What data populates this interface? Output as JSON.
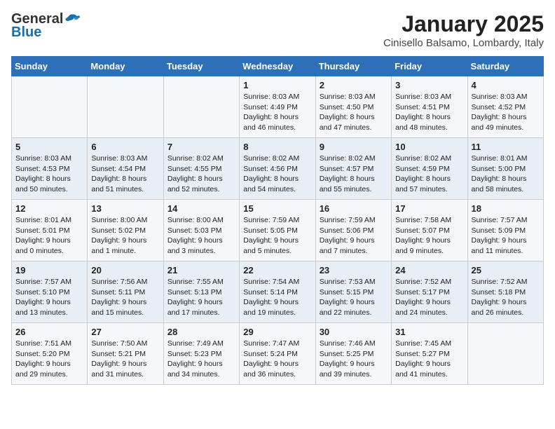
{
  "logo": {
    "general": "General",
    "blue": "Blue"
  },
  "header": {
    "month": "January 2025",
    "location": "Cinisello Balsamo, Lombardy, Italy"
  },
  "weekdays": [
    "Sunday",
    "Monday",
    "Tuesday",
    "Wednesday",
    "Thursday",
    "Friday",
    "Saturday"
  ],
  "weeks": [
    [
      {
        "day": "",
        "info": ""
      },
      {
        "day": "",
        "info": ""
      },
      {
        "day": "",
        "info": ""
      },
      {
        "day": "1",
        "info": "Sunrise: 8:03 AM\nSunset: 4:49 PM\nDaylight: 8 hours and 46 minutes."
      },
      {
        "day": "2",
        "info": "Sunrise: 8:03 AM\nSunset: 4:50 PM\nDaylight: 8 hours and 47 minutes."
      },
      {
        "day": "3",
        "info": "Sunrise: 8:03 AM\nSunset: 4:51 PM\nDaylight: 8 hours and 48 minutes."
      },
      {
        "day": "4",
        "info": "Sunrise: 8:03 AM\nSunset: 4:52 PM\nDaylight: 8 hours and 49 minutes."
      }
    ],
    [
      {
        "day": "5",
        "info": "Sunrise: 8:03 AM\nSunset: 4:53 PM\nDaylight: 8 hours and 50 minutes."
      },
      {
        "day": "6",
        "info": "Sunrise: 8:03 AM\nSunset: 4:54 PM\nDaylight: 8 hours and 51 minutes."
      },
      {
        "day": "7",
        "info": "Sunrise: 8:02 AM\nSunset: 4:55 PM\nDaylight: 8 hours and 52 minutes."
      },
      {
        "day": "8",
        "info": "Sunrise: 8:02 AM\nSunset: 4:56 PM\nDaylight: 8 hours and 54 minutes."
      },
      {
        "day": "9",
        "info": "Sunrise: 8:02 AM\nSunset: 4:57 PM\nDaylight: 8 hours and 55 minutes."
      },
      {
        "day": "10",
        "info": "Sunrise: 8:02 AM\nSunset: 4:59 PM\nDaylight: 8 hours and 57 minutes."
      },
      {
        "day": "11",
        "info": "Sunrise: 8:01 AM\nSunset: 5:00 PM\nDaylight: 8 hours and 58 minutes."
      }
    ],
    [
      {
        "day": "12",
        "info": "Sunrise: 8:01 AM\nSunset: 5:01 PM\nDaylight: 9 hours and 0 minutes."
      },
      {
        "day": "13",
        "info": "Sunrise: 8:00 AM\nSunset: 5:02 PM\nDaylight: 9 hours and 1 minute."
      },
      {
        "day": "14",
        "info": "Sunrise: 8:00 AM\nSunset: 5:03 PM\nDaylight: 9 hours and 3 minutes."
      },
      {
        "day": "15",
        "info": "Sunrise: 7:59 AM\nSunset: 5:05 PM\nDaylight: 9 hours and 5 minutes."
      },
      {
        "day": "16",
        "info": "Sunrise: 7:59 AM\nSunset: 5:06 PM\nDaylight: 9 hours and 7 minutes."
      },
      {
        "day": "17",
        "info": "Sunrise: 7:58 AM\nSunset: 5:07 PM\nDaylight: 9 hours and 9 minutes."
      },
      {
        "day": "18",
        "info": "Sunrise: 7:57 AM\nSunset: 5:09 PM\nDaylight: 9 hours and 11 minutes."
      }
    ],
    [
      {
        "day": "19",
        "info": "Sunrise: 7:57 AM\nSunset: 5:10 PM\nDaylight: 9 hours and 13 minutes."
      },
      {
        "day": "20",
        "info": "Sunrise: 7:56 AM\nSunset: 5:11 PM\nDaylight: 9 hours and 15 minutes."
      },
      {
        "day": "21",
        "info": "Sunrise: 7:55 AM\nSunset: 5:13 PM\nDaylight: 9 hours and 17 minutes."
      },
      {
        "day": "22",
        "info": "Sunrise: 7:54 AM\nSunset: 5:14 PM\nDaylight: 9 hours and 19 minutes."
      },
      {
        "day": "23",
        "info": "Sunrise: 7:53 AM\nSunset: 5:15 PM\nDaylight: 9 hours and 22 minutes."
      },
      {
        "day": "24",
        "info": "Sunrise: 7:52 AM\nSunset: 5:17 PM\nDaylight: 9 hours and 24 minutes."
      },
      {
        "day": "25",
        "info": "Sunrise: 7:52 AM\nSunset: 5:18 PM\nDaylight: 9 hours and 26 minutes."
      }
    ],
    [
      {
        "day": "26",
        "info": "Sunrise: 7:51 AM\nSunset: 5:20 PM\nDaylight: 9 hours and 29 minutes."
      },
      {
        "day": "27",
        "info": "Sunrise: 7:50 AM\nSunset: 5:21 PM\nDaylight: 9 hours and 31 minutes."
      },
      {
        "day": "28",
        "info": "Sunrise: 7:49 AM\nSunset: 5:23 PM\nDaylight: 9 hours and 34 minutes."
      },
      {
        "day": "29",
        "info": "Sunrise: 7:47 AM\nSunset: 5:24 PM\nDaylight: 9 hours and 36 minutes."
      },
      {
        "day": "30",
        "info": "Sunrise: 7:46 AM\nSunset: 5:25 PM\nDaylight: 9 hours and 39 minutes."
      },
      {
        "day": "31",
        "info": "Sunrise: 7:45 AM\nSunset: 5:27 PM\nDaylight: 9 hours and 41 minutes."
      },
      {
        "day": "",
        "info": ""
      }
    ]
  ]
}
